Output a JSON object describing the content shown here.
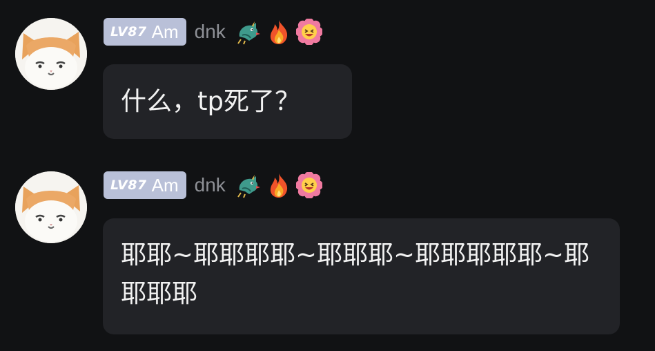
{
  "messages": [
    {
      "level_badge": {
        "prefix": "LV87",
        "tag": "Am",
        "bg_color": "#b9c0d8"
      },
      "username": "dnk",
      "badges": [
        "dragon-icon",
        "fire-icon",
        "smiling-face-flower-icon"
      ],
      "text": "什么，tp死了？"
    },
    {
      "level_badge": {
        "prefix": "LV87",
        "tag": "Am",
        "bg_color": "#b9c0d8"
      },
      "username": "dnk",
      "badges": [
        "dragon-icon",
        "fire-icon",
        "smiling-face-flower-icon"
      ],
      "text": "耶耶~耶耶耶耶~耶耶耶~耶耶耶耶耶~耶耶耶耶"
    }
  ],
  "colors": {
    "background": "#111214",
    "bubble": "#222327",
    "message_text": "#f2f2f2",
    "username": "#8e9096"
  }
}
